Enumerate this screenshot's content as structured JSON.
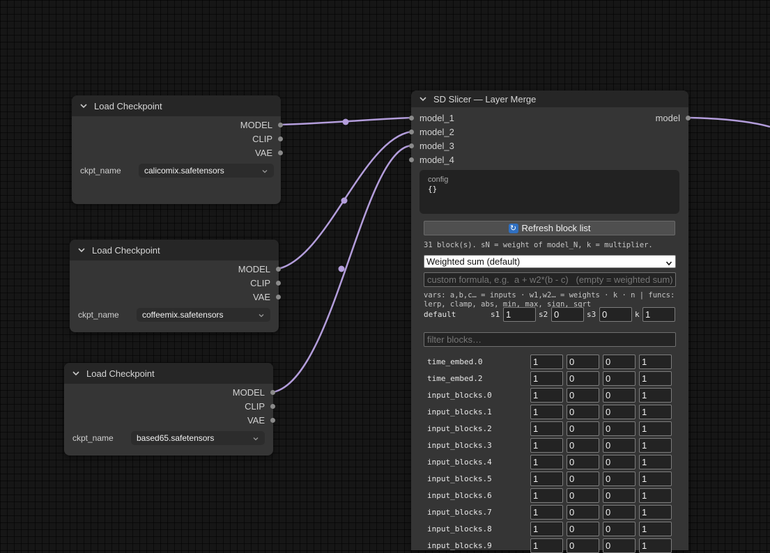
{
  "nodes": {
    "ckpt1": {
      "title": "Load Checkpoint",
      "outputs": [
        "MODEL",
        "CLIP",
        "VAE"
      ],
      "widget": {
        "name": "ckpt_name",
        "value": "calicomix.safetensors"
      }
    },
    "ckpt2": {
      "title": "Load Checkpoint",
      "outputs": [
        "MODEL",
        "CLIP",
        "VAE"
      ],
      "widget": {
        "name": "ckpt_name",
        "value": "coffeemix.safetensors"
      }
    },
    "ckpt3": {
      "title": "Load Checkpoint",
      "outputs": [
        "MODEL",
        "CLIP",
        "VAE"
      ],
      "widget": {
        "name": "ckpt_name",
        "value": "based65.safetensors"
      }
    },
    "slicer": {
      "title": "SD Slicer — Layer Merge",
      "inputs": [
        "model_1",
        "model_2",
        "model_3",
        "model_4"
      ],
      "output": "model",
      "config": {
        "label": "config",
        "value": "{}"
      },
      "refresh_label": "Refresh block list",
      "refresh_icon": "refresh-icon",
      "info": "31 block(s). sN = weight of model_N, k = multiplier.",
      "mode": "Weighted sum (default)",
      "formula_placeholder": "custom formula, e.g.  a + w2*(b - c)   (empty = weighted sum)",
      "vars_help": "vars: a,b,c… = inputs · w1,w2… = weights · k · n | funcs:\nlerp, clamp, abs, min, max, sign, sqrt",
      "default_row": {
        "label": "default",
        "s1_label": "s1",
        "s1": "1",
        "s2_label": "s2",
        "s2": "0",
        "s3_label": "s3",
        "s3": "0",
        "k_label": "k",
        "k": "1"
      },
      "filter_placeholder": "filter blocks…",
      "blocks": [
        {
          "name": "time_embed.0",
          "s1": "1",
          "s2": "0",
          "s3": "0",
          "k": "1"
        },
        {
          "name": "time_embed.2",
          "s1": "1",
          "s2": "0",
          "s3": "0",
          "k": "1"
        },
        {
          "name": "input_blocks.0",
          "s1": "1",
          "s2": "0",
          "s3": "0",
          "k": "1"
        },
        {
          "name": "input_blocks.1",
          "s1": "1",
          "s2": "0",
          "s3": "0",
          "k": "1"
        },
        {
          "name": "input_blocks.2",
          "s1": "1",
          "s2": "0",
          "s3": "0",
          "k": "1"
        },
        {
          "name": "input_blocks.3",
          "s1": "1",
          "s2": "0",
          "s3": "0",
          "k": "1"
        },
        {
          "name": "input_blocks.4",
          "s1": "1",
          "s2": "0",
          "s3": "0",
          "k": "1"
        },
        {
          "name": "input_blocks.5",
          "s1": "1",
          "s2": "0",
          "s3": "0",
          "k": "1"
        },
        {
          "name": "input_blocks.6",
          "s1": "1",
          "s2": "0",
          "s3": "0",
          "k": "1"
        },
        {
          "name": "input_blocks.7",
          "s1": "1",
          "s2": "0",
          "s3": "0",
          "k": "1"
        },
        {
          "name": "input_blocks.8",
          "s1": "1",
          "s2": "0",
          "s3": "0",
          "k": "1"
        },
        {
          "name": "input_blocks.9",
          "s1": "1",
          "s2": "0",
          "s3": "0",
          "k": "1"
        }
      ]
    }
  },
  "colors": {
    "canvas": "#161616",
    "node_body": "#353535",
    "node_header": "#262626",
    "link_model": "#b39ddb",
    "slot_dot": "#8a8a8a"
  }
}
